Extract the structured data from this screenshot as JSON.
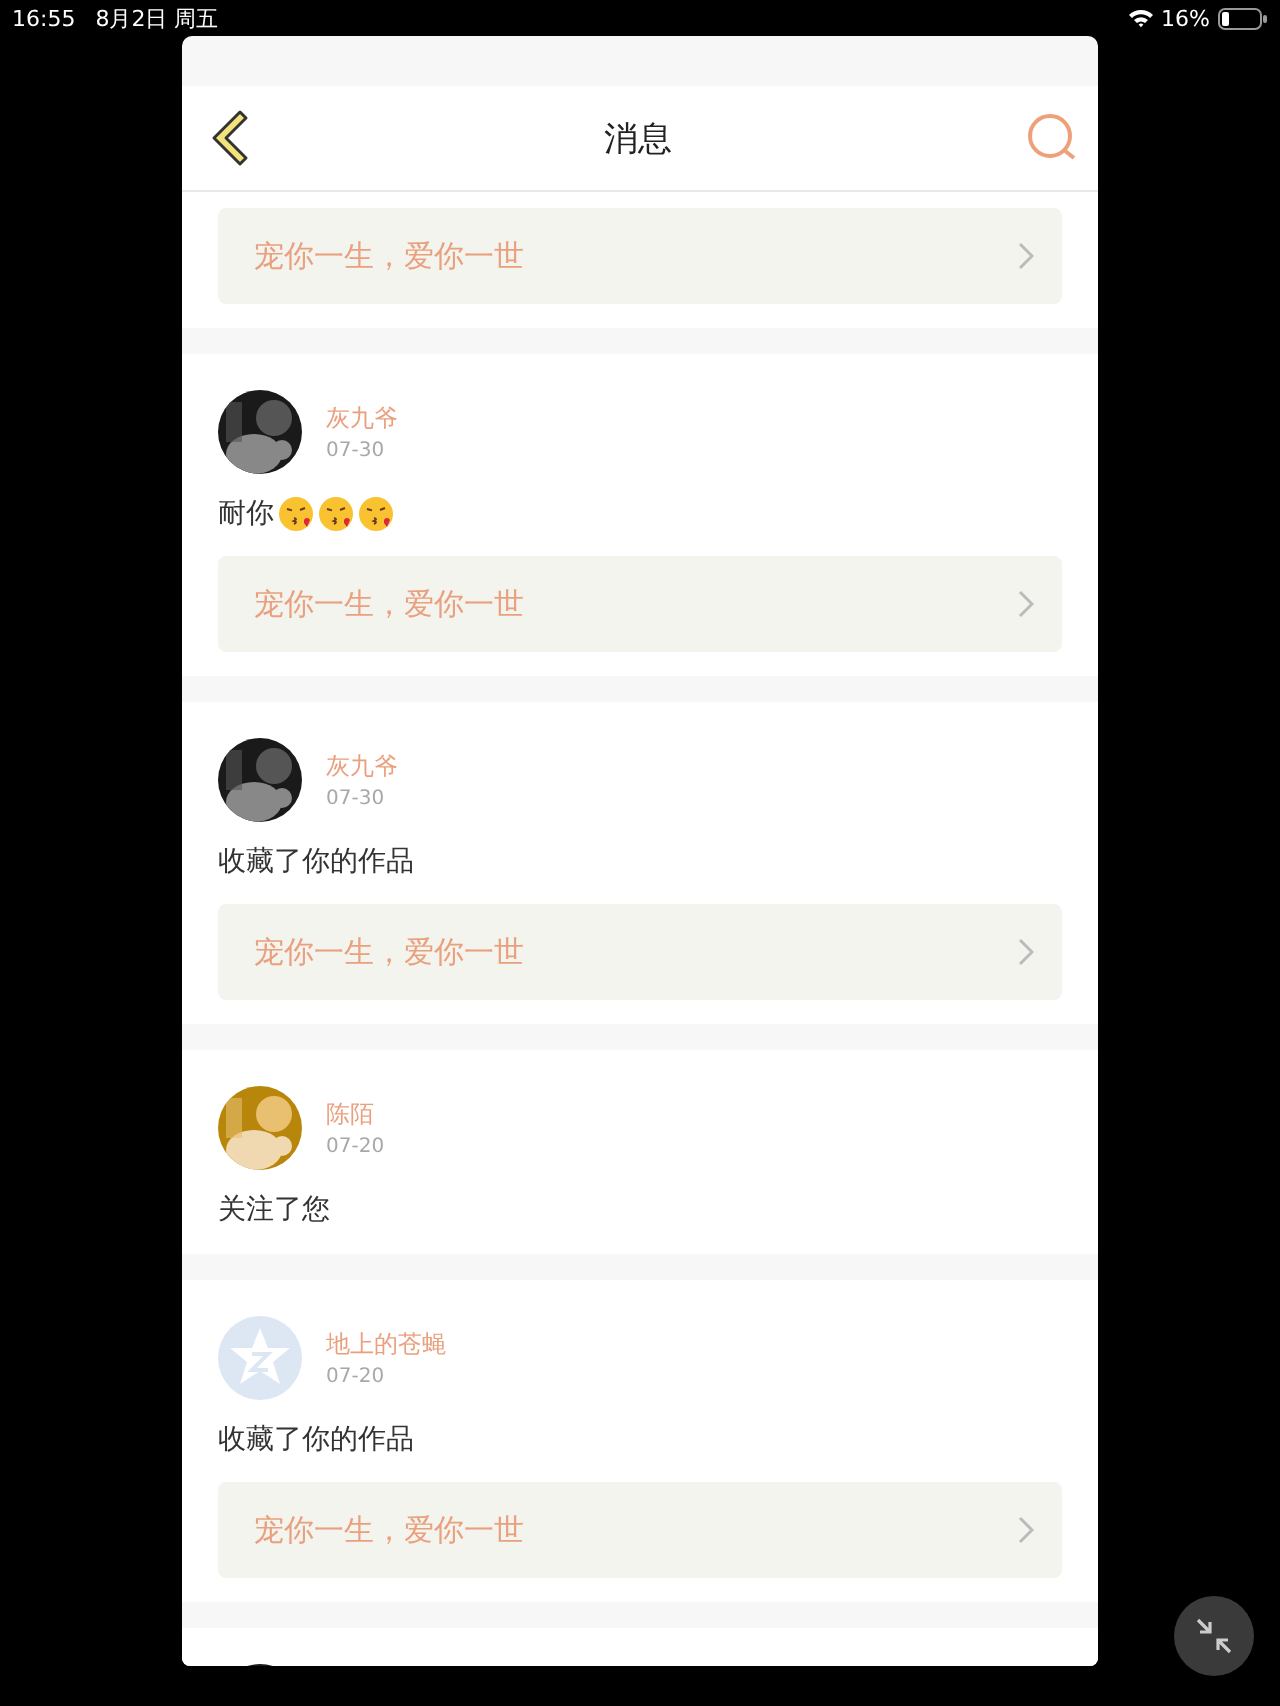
{
  "status_bar": {
    "time": "16:55",
    "date": "8月2日 周五",
    "battery": "16%"
  },
  "header": {
    "title": "消息"
  },
  "messages": [
    {
      "link": "宠你一生，爱你一世"
    },
    {
      "avatar": {
        "kind": "picture"
      },
      "name": "灰九爷",
      "date": "07-30",
      "text": "耐你",
      "emojis": [
        {
          "kind": "kiss"
        },
        {
          "kind": "kiss"
        },
        {
          "kind": "kiss"
        }
      ],
      "link": "宠你一生，爱你一世"
    },
    {
      "avatar": {
        "kind": "picture"
      },
      "name": "灰九爷",
      "date": "07-30",
      "text": "收藏了你的作品",
      "link": "宠你一生，爱你一世"
    },
    {
      "avatar": {
        "kind": "picture"
      },
      "name": "陈陌",
      "date": "07-20",
      "text": "关注了您"
    },
    {
      "avatar": {
        "kind": "default"
      },
      "name": "地上的苍蝇",
      "date": "07-20",
      "text": "收藏了你的作品",
      "link": "宠你一生，爱你一世"
    },
    {
      "avatar": {
        "kind": "picture"
      }
    }
  ]
}
